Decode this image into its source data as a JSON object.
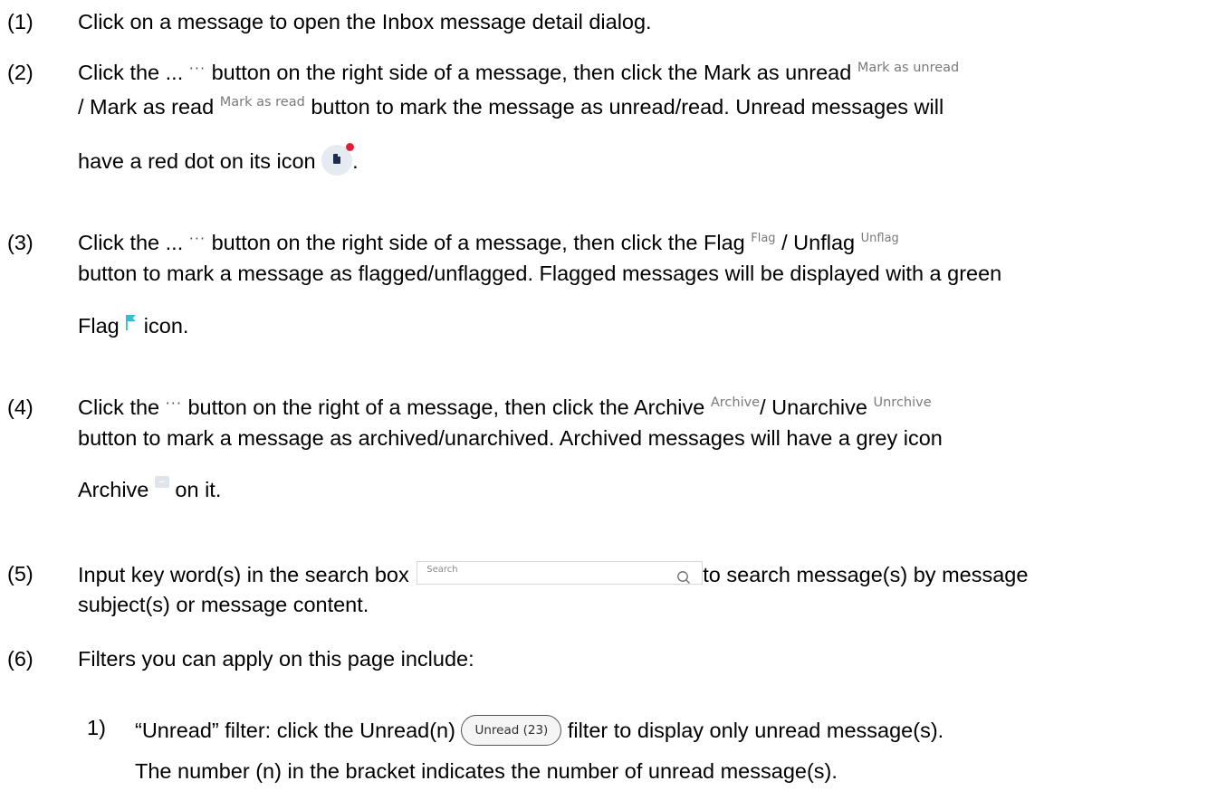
{
  "items": [
    {
      "num": "(1)",
      "text": "Click on a message to open the Inbox message detail dialog."
    },
    {
      "num": "(2)",
      "l1a": "Click the ... ",
      "dots": "···",
      "l1b": " button on the right side of a message, then click the Mark as unread ",
      "label_mark_unread": "Mark as unread",
      "l2a": "/ Mark as read ",
      "label_mark_read": "Mark as read",
      "l2b": " button to mark the message as unread/read. Unread messages will",
      "l3a": "have a red dot on its icon ",
      "l3b": "."
    },
    {
      "num": "(3)",
      "l1a": "Click the ... ",
      "dots": "···",
      "l1b": " button on the right side of a message, then click the Flag ",
      "label_flag": "Flag",
      "l1c": "/ Unflag ",
      "label_unflag": "Unflag",
      "l2": "button to mark a message as flagged/unflagged. Flagged messages will be displayed with a green",
      "l3a": "Flag ",
      "l3b": " icon."
    },
    {
      "num": "(4)",
      "l1a": "Click the ",
      "dots": "···",
      "l1b": " button on the right of a message, then click the Archive ",
      "label_archive": "Archive",
      "l1c": "/ Unarchive ",
      "label_unarchive": "Unrchive",
      "l2": "button to mark a message as archived/unarchived. Archived messages will have a grey icon",
      "l3a": "Archive ",
      "l3b": " on it."
    },
    {
      "num": "(5)",
      "l1a": "Input key word(s) in the search box ",
      "search_placeholder": "Search",
      "l1b": "to search message(s) by message",
      "l2": "subject(s) or message content."
    },
    {
      "num": "(6)",
      "text": "Filters you can apply on this page include:"
    }
  ],
  "sub_items": [
    {
      "num": "1)",
      "l1a": "“Unread”  filter: click the Unread(n) ",
      "pill": "Unread (23)",
      "l1b": " filter to display only unread message(s).",
      "l2": "The number (n) in the bracket indicates the number of unread message(s)."
    }
  ],
  "colors": {
    "unread_dot": "#e01e37",
    "flag": "#2fc0d6",
    "archive": "#dfe3ea",
    "doc": "#1c2d4f"
  },
  "icons": [
    "ellipsis-icon",
    "doc-unread-icon",
    "flag-icon",
    "archive-icon",
    "search-icon"
  ]
}
